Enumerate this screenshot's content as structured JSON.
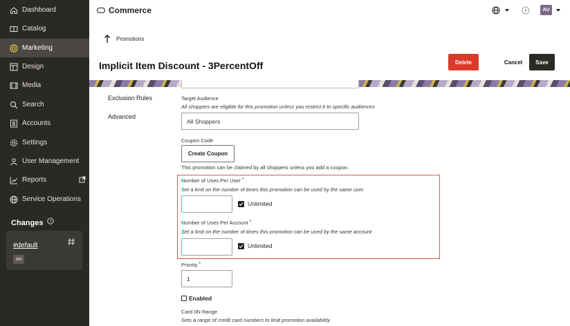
{
  "sidebar": {
    "items": [
      {
        "label": "Dashboard",
        "icon": "home-icon"
      },
      {
        "label": "Catalog",
        "icon": "book-icon"
      },
      {
        "label": "Marketing",
        "icon": "target-icon",
        "active": true
      },
      {
        "label": "Design",
        "icon": "layout-icon"
      },
      {
        "label": "Media",
        "icon": "film-icon"
      },
      {
        "label": "Search",
        "icon": "search-icon"
      },
      {
        "label": "Accounts",
        "icon": "accounts-icon"
      },
      {
        "label": "Settings",
        "icon": "gear-icon"
      },
      {
        "label": "User Management",
        "icon": "user-icon"
      },
      {
        "label": "Reports",
        "icon": "chart-icon"
      },
      {
        "label": "Service Operations",
        "icon": "globe-icon"
      }
    ],
    "changes": {
      "title": "Changes",
      "link": "#default",
      "avatar": "AU"
    }
  },
  "topbar": {
    "brand": "Commerce",
    "user_initials": "AU"
  },
  "header": {
    "breadcrumb": "Promotions",
    "title": "Implicit Item Discount - 3PercentOff",
    "delete_label": "Delete",
    "cancel_label": "Cancel",
    "save_label": "Save"
  },
  "sections": {
    "exclusion_rules": "Exclusion Rules",
    "advanced": "Advanced"
  },
  "form": {
    "target_audience": {
      "label": "Target Audience",
      "helper": "All shoppers are eligible for this promotion unless you restrict it to specific audiences",
      "value": "All Shoppers"
    },
    "coupon_code": {
      "label": "Coupon Code",
      "button": "Create Coupon",
      "helper": "This promotion can be claimed by all shoppers unless you add a coupon."
    },
    "uses_per_user": {
      "label": "Number of Uses Per User",
      "required": "*",
      "helper": "Set a limit on the number of times this promotion can be used by the same user",
      "value": "",
      "unlimited_label": "Unlimited",
      "unlimited_checked": true
    },
    "uses_per_account": {
      "label": "Number of Uses Per Account",
      "required": "*",
      "helper": "Set a limit on the number of times this promotion can be used by the same account",
      "value": "",
      "unlimited_label": "Unlimited",
      "unlimited_checked": true
    },
    "priority": {
      "label": "Priority",
      "required": "*",
      "value": "1"
    },
    "enabled": {
      "label": "Enabled",
      "checked": false
    },
    "card_iin_range": {
      "label": "Card IIN Range",
      "helper": "Sets a range of credit card numbers to limit promotion availability."
    }
  },
  "colors": {
    "sidebar_bg": "#2b2926",
    "active_item_bg": "#4a4744",
    "delete_button": "#d93a2b",
    "save_button": "#2c2a27",
    "highlight_border": "#d9534f"
  }
}
